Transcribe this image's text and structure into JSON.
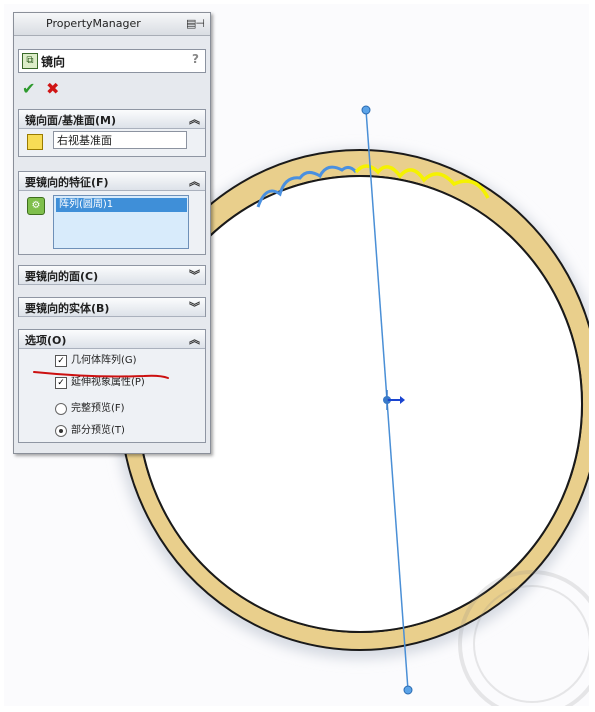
{
  "panel": {
    "title": "PropertyManager",
    "feature_title": "镜向",
    "help": "?",
    "ok_symbol": "✔",
    "cancel_symbol": "✖"
  },
  "sections": {
    "mirror_plane": {
      "label": "镜向面/基准面(M)",
      "chevron": "︽",
      "value": "右视基准面"
    },
    "features": {
      "label": "要镜向的特征(F)",
      "chevron": "︽",
      "items": [
        "阵列(圆周)1"
      ]
    },
    "faces": {
      "label": "要镜向的面(C)",
      "chevron": "︾"
    },
    "bodies": {
      "label": "要镜向的实体(B)",
      "chevron": "︾"
    },
    "options": {
      "label": "选项(O)",
      "chevron": "︽",
      "geometry_pattern": {
        "label": "几何体阵列(G)",
        "checked": true
      },
      "propagate_visual": {
        "label": "延伸视象属性(P)",
        "checked": true
      },
      "full_preview": {
        "label": "完整预览(F)",
        "selected": false
      },
      "partial_preview": {
        "label": "部分预览(T)",
        "selected": true
      }
    }
  },
  "colors": {
    "ring_fill": "#e9cf8c",
    "ring_edge": "#1a1a1a",
    "highlight_blue": "#4a90e0",
    "highlight_yellow": "#f5f200",
    "axis_line": "#4a8fd6",
    "annotation_red": "#cc1010"
  }
}
